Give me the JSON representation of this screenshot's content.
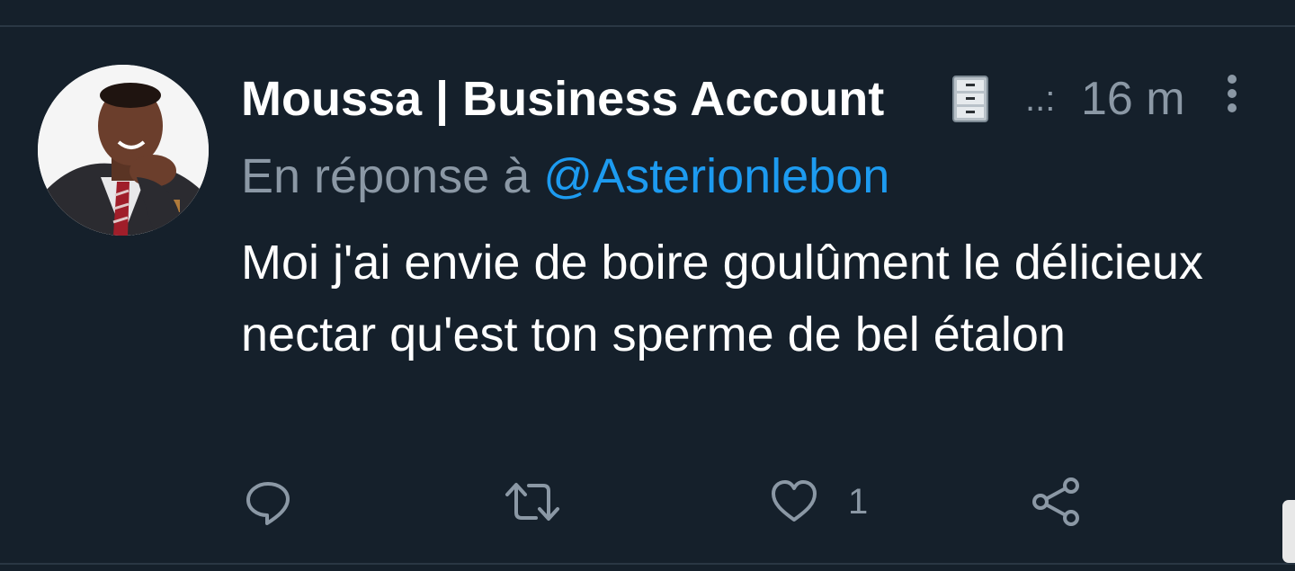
{
  "tweet": {
    "author_name": "Moussa | Business Account",
    "badge_icon": "file-cabinet-icon",
    "timestamp_prefix": "..:",
    "timestamp": "16 m",
    "reply_prefix": "En réponse à ",
    "reply_handle": "@Asterionlebon",
    "text": "Moi j'ai envie de boire goulûment le délicieux nectar qu'est ton sperme de bel étalon"
  },
  "actions": {
    "reply_icon": "comment-icon",
    "retweet_icon": "retweet-icon",
    "like_icon": "heart-icon",
    "like_count": "1",
    "share_icon": "share-icon"
  },
  "colors": {
    "background": "#15202b",
    "primary_text": "#ffffff",
    "secondary_text": "#8b98a5",
    "link": "#1d9bf0"
  }
}
